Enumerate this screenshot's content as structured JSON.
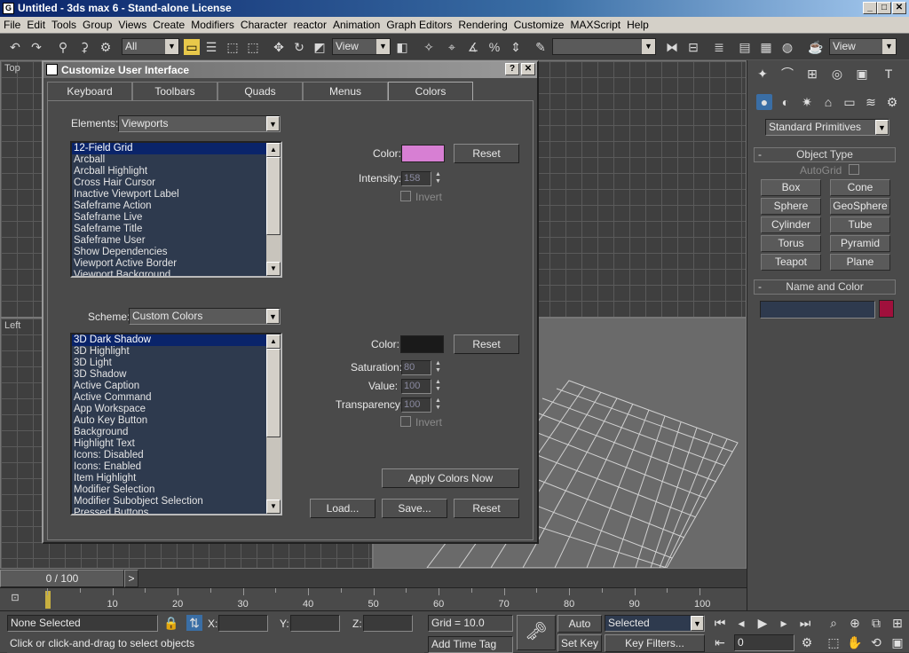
{
  "window": {
    "title": "Untitled - 3ds max 6 - Stand-alone License",
    "min": "_",
    "max": "□",
    "close": "✕"
  },
  "menu": [
    "File",
    "Edit",
    "Tools",
    "Group",
    "Views",
    "Create",
    "Modifiers",
    "Character",
    "reactor",
    "Animation",
    "Graph Editors",
    "Rendering",
    "Customize",
    "MAXScript",
    "Help"
  ],
  "toolbar": {
    "selection_filter": "All",
    "ref_coord": "View",
    "named_sel": "",
    "view_combo": "View"
  },
  "viewports": {
    "top_label": "Top",
    "left_label": "Left"
  },
  "dialog": {
    "title": "Customize User Interface",
    "help": "?",
    "close": "✕",
    "tabs": [
      "Keyboard",
      "Toolbars",
      "Quads",
      "Menus",
      "Colors"
    ],
    "active_tab": "Colors",
    "elements_label": "Elements:",
    "elements_value": "Viewports",
    "elements_list": [
      "12-Field Grid",
      "Arcball",
      "Arcball Highlight",
      "Cross Hair Cursor",
      "Inactive Viewport Label",
      "Safeframe Action",
      "Safeframe Live",
      "Safeframe Title",
      "Safeframe User",
      "Show Dependencies",
      "Viewport Active Border",
      "Viewport Background"
    ],
    "elements_selected": "12-Field Grid",
    "color_label": "Color:",
    "color_value": "#d77fd3",
    "reset_label": "Reset",
    "intensity_label": "Intensity:",
    "intensity_value": "158",
    "invert_label": "Invert",
    "scheme_label": "Scheme:",
    "scheme_value": "Custom Colors",
    "scheme_list": [
      "3D Dark Shadow",
      "3D Highlight",
      "3D Light",
      "3D Shadow",
      "Active Caption",
      "Active Command",
      "App Workspace",
      "Auto Key Button",
      "Background",
      "Highlight Text",
      "Icons: Disabled",
      "Icons: Enabled",
      "Item Highlight",
      "Modifier Selection",
      "Modifier Subobject Selection",
      "Pressed Buttons"
    ],
    "scheme_selected": "3D Dark Shadow",
    "scheme_color_label": "Color:",
    "scheme_color_value": "#1a1a1a",
    "scheme_reset_label": "Reset",
    "saturation_label": "Saturation:",
    "saturation_value": "80",
    "value_label": "Value:",
    "value_value": "100",
    "transparency_label": "Transparency:",
    "transparency_value": "100",
    "invert2_label": "Invert",
    "apply_label": "Apply Colors Now",
    "load_label": "Load...",
    "save_label": "Save...",
    "reset_bottom_label": "Reset"
  },
  "command_panel": {
    "category": "Standard Primitives",
    "object_type_title": "Object Type",
    "autogrid_label": "AutoGrid",
    "buttons": [
      "Box",
      "Cone",
      "Sphere",
      "GeoSphere",
      "Cylinder",
      "Tube",
      "Torus",
      "Pyramid",
      "Teapot",
      "Plane"
    ],
    "name_color_title": "Name and Color",
    "name_value": "",
    "object_color": "#a0103c"
  },
  "timeline": {
    "position": "0 / 100",
    "next": ">",
    "prev": "<",
    "ticks": [
      "10",
      "20",
      "30",
      "40",
      "50",
      "60",
      "70",
      "80",
      "90",
      "100"
    ]
  },
  "status": {
    "selection": "None Selected",
    "prompt": "Click or click-and-drag to select objects",
    "x_label": "X:",
    "y_label": "Y:",
    "z_label": "Z:",
    "grid": "Grid = 10.0",
    "add_time_tag": "Add Time Tag",
    "auto_key": "Auto Key",
    "set_key": "Set Key",
    "selected_combo": "Selected",
    "key_filters": "Key Filters...",
    "frame": "0"
  }
}
